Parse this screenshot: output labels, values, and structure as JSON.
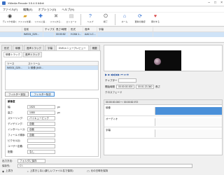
{
  "window": {
    "title": "XMedia Recode 3.5.4.5 64bit"
  },
  "menu": [
    "ファイル(F)",
    "編集(E)",
    "オプション(O)",
    "ヘルプ(H)"
  ],
  "toolbar": [
    {
      "icon": "disc-icon",
      "label": "ディスクを開く"
    },
    {
      "icon": "folder-icon",
      "label": "ファイルを開..."
    },
    {
      "icon": "add-icon",
      "label": "リストに追..."
    },
    {
      "icon": "remove-icon",
      "label": "リストから..."
    },
    {
      "icon": "encode-icon",
      "label": "エンコード"
    },
    {
      "icon": "help-icon",
      "label": "ヘルプ"
    },
    {
      "icon": "exit-icon",
      "label": "終了"
    },
    {
      "icon": "home-icon",
      "label": "ホーム"
    },
    {
      "icon": "update-icon",
      "label": "更新の確認"
    },
    {
      "icon": "donate-icon",
      "label": "寄付する"
    }
  ],
  "filelist": {
    "headers": [
      "",
      "名前",
      "チャプター",
      "長さ/時間",
      "形式",
      "音声",
      "字幕"
    ],
    "rows": [
      [
        "",
        "IMG01_D20...",
        "",
        "00:00:52",
        "H.264 1...",
        "AAC LC...",
        ""
      ]
    ]
  },
  "tabs": [
    "形式",
    "映像",
    "音声トラック",
    "字幕",
    "DVDメニュープレビュー",
    "概要"
  ],
  "active_tab": 4,
  "subtabs": [
    "映像トラック",
    "音声トラック"
  ],
  "stream": {
    "headers": [
      "ソース",
      "ストリーム",
      ""
    ],
    "rows": [
      [
        "IMG01_D20...",
        "1: 映像 (640...",
        ""
      ]
    ]
  },
  "filter_buttons": [
    "フィルター追加",
    "フィルター除去"
  ],
  "props": {
    "header": "解像度",
    "rows": [
      {
        "label": "幅:",
        "value": "1920",
        "unit": "px"
      },
      {
        "label": "高さ:",
        "value": "1080",
        "unit": "px"
      },
      {
        "label": "スケーリング:",
        "value": "バイキュービック"
      },
      {
        "label": "ディザリング:",
        "value": "自動"
      },
      {
        "label": "インターレース:",
        "value": "自動"
      },
      {
        "label": "フィールド順序:",
        "value": "自動"
      },
      {
        "label": "ピクセル比:",
        "value": ""
      },
      {
        "label": "ユーザー定義:",
        "value": ""
      },
      {
        "label": "配置:",
        "value": "なし"
      }
    ]
  },
  "bottom": {
    "output_label": "出力方法:",
    "output_value": "フォルダに保存",
    "dest_label": "保存先:",
    "dest_value": "C:\\",
    "overwrite_label": "上書き",
    "check1": "上書きしない(新しいファイル名で保存)",
    "check2": "元の日時を保持"
  },
  "preview": {
    "play_controls": "▶ ■ ◀◀ ▶▶ ⏮ ⏭ ⏺",
    "start_label": "開始時間",
    "start_value": "00:00:00.000",
    "end_value": "00:01:23.360",
    "duration_label": "長さ",
    "chapter_label": "チャプター",
    "crossfade": "クロスフェード",
    "timeline_header": "タイムライン",
    "tracks": [
      {
        "label": "映像",
        "kind": "video"
      },
      {
        "label": "オーディオ",
        "kind": "audio"
      },
      {
        "label": "字幕",
        "kind": "sub"
      }
    ],
    "timecode": "00:00:00.000 ～ 00:00:52.972",
    "zoom_value": "1"
  },
  "colors": {
    "accent": "#4a90d9",
    "selected_row": "#cfe3f7"
  }
}
